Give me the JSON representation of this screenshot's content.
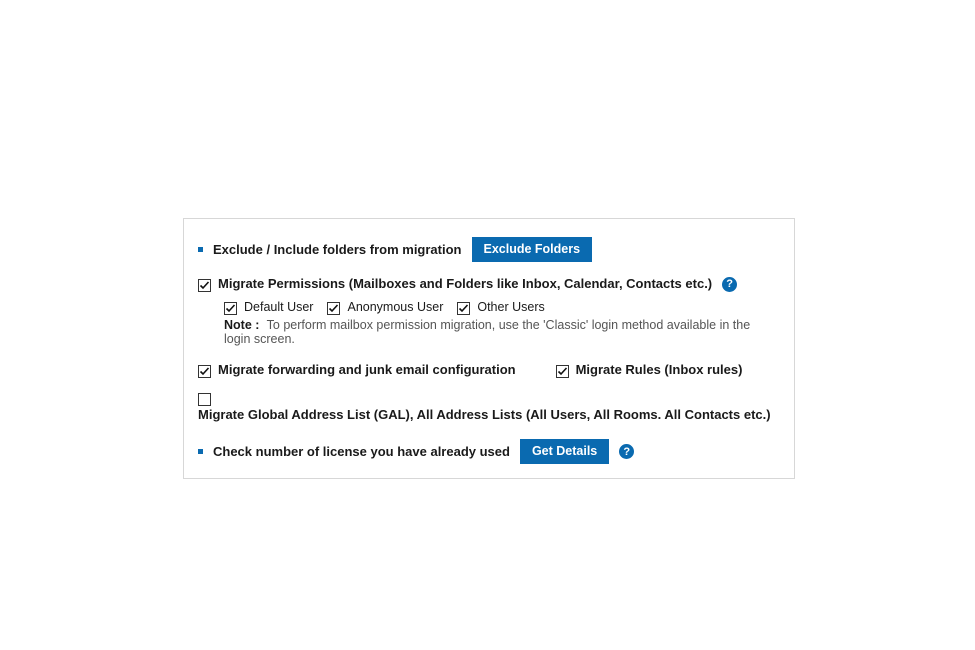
{
  "row1": {
    "label": "Exclude / Include folders from migration",
    "button": "Exclude Folders"
  },
  "row2": {
    "label": "Migrate Permissions (Mailboxes and Folders like Inbox, Calendar, Contacts etc.)",
    "sub": {
      "default_user": "Default User",
      "anonymous_user": "Anonymous User",
      "other_users": "Other Users"
    },
    "note_label": "Note :",
    "note_text": "To perform mailbox permission migration, use the 'Classic' login method available in the login screen."
  },
  "row3": {
    "forwarding": "Migrate forwarding and junk email configuration",
    "rules": "Migrate Rules (Inbox rules)"
  },
  "row4": {
    "label": "Migrate Global Address List (GAL), All Address Lists (All Users, All Rooms. All Contacts etc.)"
  },
  "row5": {
    "label": "Check number of license you have already used",
    "button": "Get Details"
  },
  "help_glyph": "?"
}
